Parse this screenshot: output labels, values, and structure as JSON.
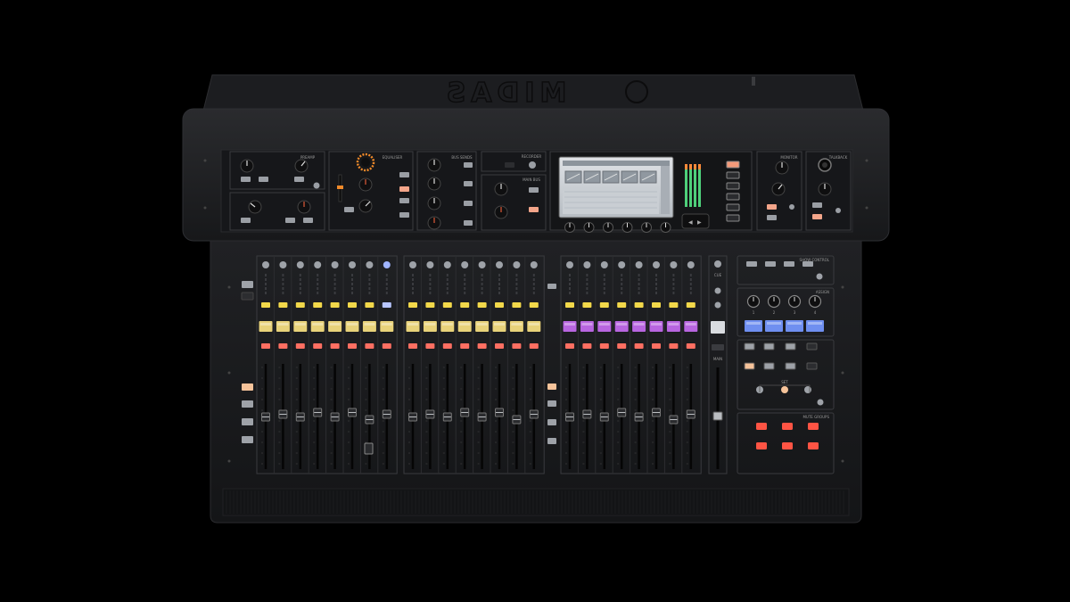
{
  "brand": {
    "logo_text": "MIDAS"
  },
  "sections": {
    "preamp": "PREAMP",
    "equaliser": "EQUALISER",
    "bus_sends": "BUS SENDS",
    "recorder": "RECORDER",
    "main_bus": "MAIN BUS",
    "monitor": "MONITOR",
    "talkback": "TALKBACK",
    "show_control": "SHOW CONTROL",
    "assign": "ASSIGN",
    "mute_groups": "MUTE GROUPS",
    "set": "SET",
    "main": "MAIN",
    "cue": "CUE"
  },
  "assign_numbers": [
    "1",
    "2",
    "3",
    "4"
  ],
  "colors": {
    "background": "#000000",
    "chassis": "#1d1e20",
    "panel": "#18191b",
    "scribble_yellow": "#e8d27a",
    "scribble_purple": "#b865e0",
    "scribble_blue": "#6f8ff0",
    "select_led": "#f2d84a",
    "mute_led": "#ff6f62",
    "mute_group_led": "#ff5444"
  },
  "icons": [
    "knob-icon",
    "fader-icon",
    "lcd-screen-icon",
    "meter-icon",
    "xlr-jack-icon"
  ]
}
